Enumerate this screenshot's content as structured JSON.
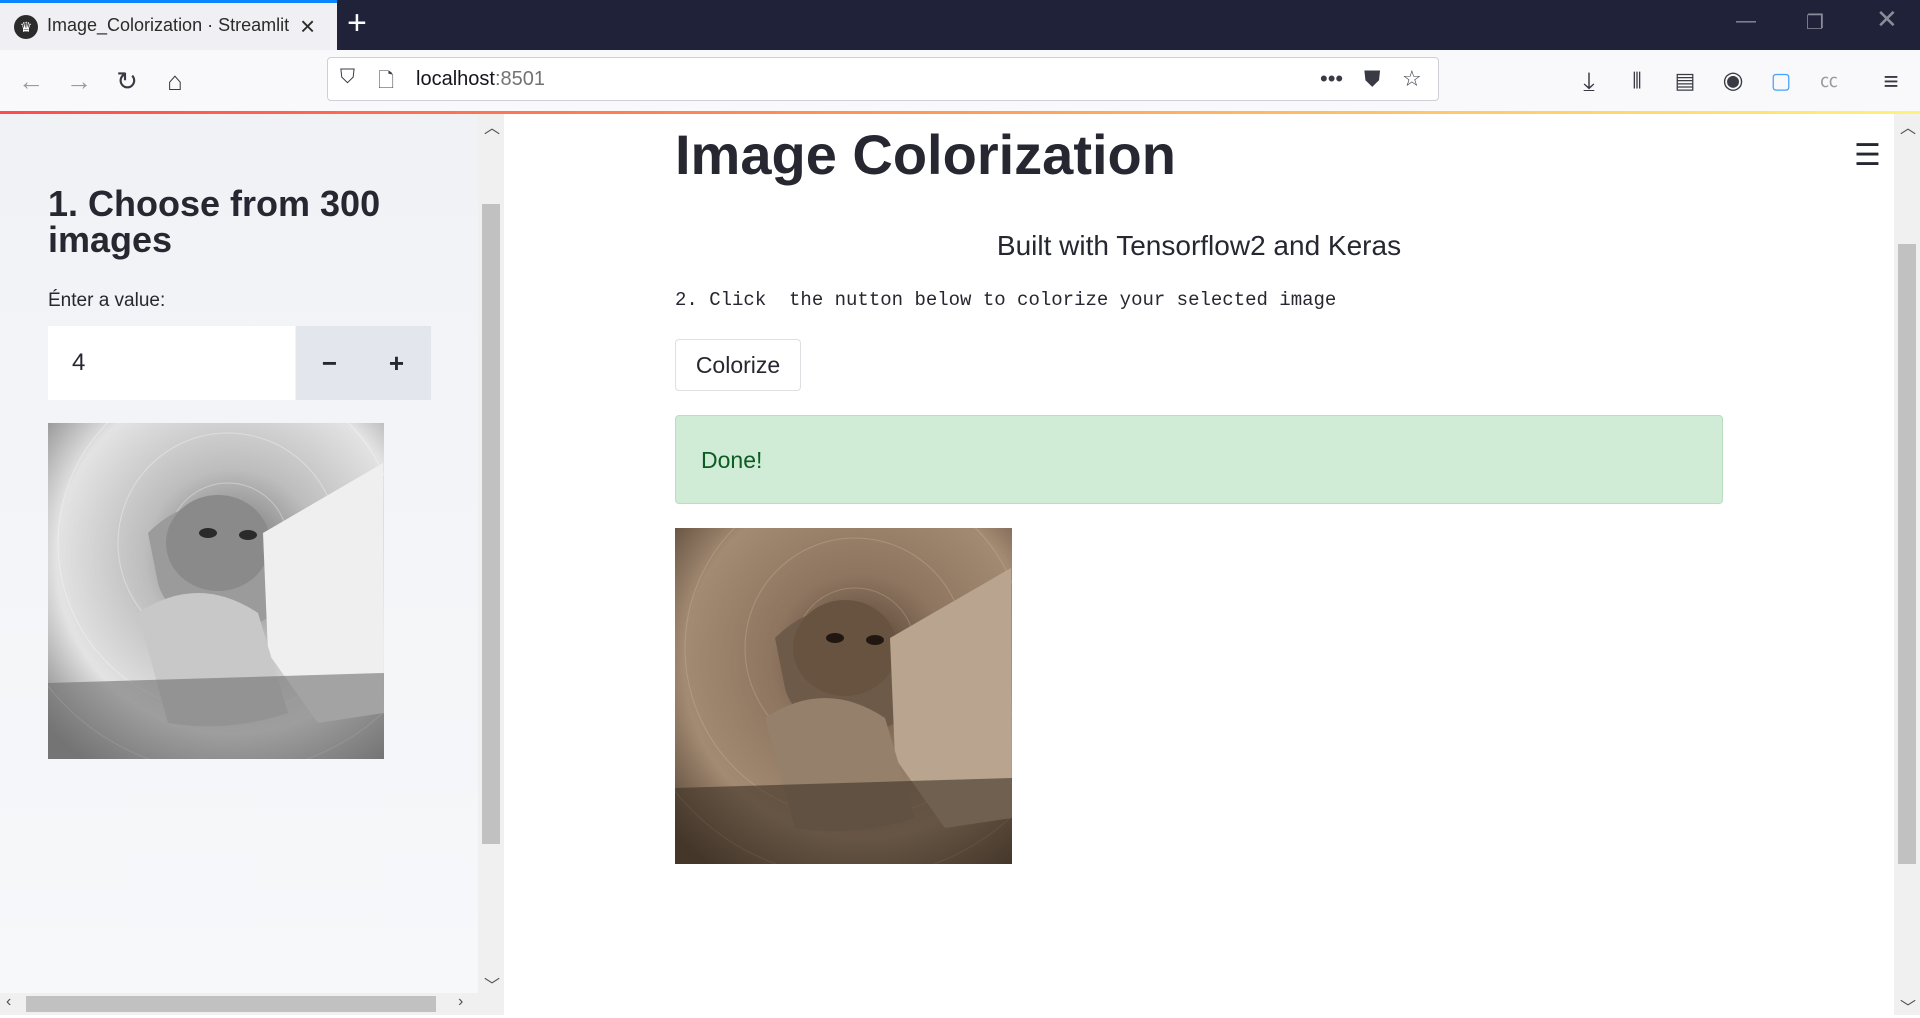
{
  "browser": {
    "tab_title": "Image_Colorization · Streamlit",
    "url_host": "localhost",
    "url_port": ":8501"
  },
  "sidebar": {
    "heading": "1. Choose from 300 images",
    "input_label": "Énter a value:",
    "input_value": "4",
    "minus_label": "−",
    "plus_label": "+"
  },
  "main": {
    "title": "Image Colorization",
    "subtitle": "Built with Tensorflow2 and Keras",
    "instruction": "2. Click  the nutton below to colorize your selected image",
    "colorize_label": "Colorize",
    "success_message": "Done!"
  },
  "colors": {
    "accent": "#ff4b4b",
    "success_bg": "#d0ecd6",
    "success_text": "#0b5b23",
    "sidebar_bg": "#f0f2f6",
    "text": "#262730"
  },
  "icons": [
    "streamlit-favicon",
    "close-icon",
    "plus-icon",
    "back-icon",
    "forward-icon",
    "reload-icon",
    "home-icon",
    "shield-icon",
    "page-icon",
    "more-icon",
    "pocket-icon",
    "star-icon",
    "download-icon",
    "library-icon",
    "sidebar-icon",
    "account-icon",
    "hamburger-icon"
  ]
}
